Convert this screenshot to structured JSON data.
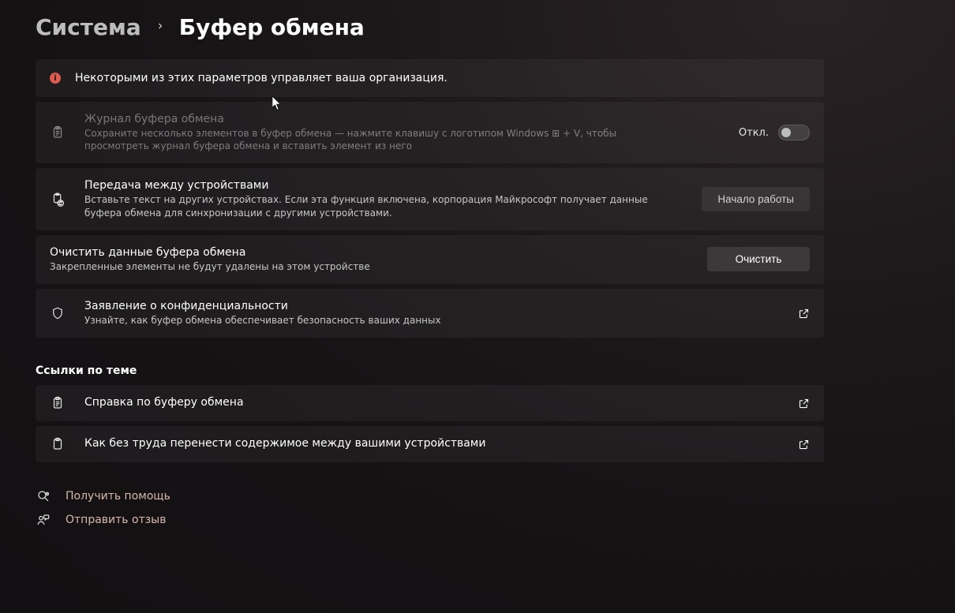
{
  "breadcrumb": {
    "parent": "Система",
    "current": "Буфер обмена"
  },
  "banner": {
    "text": "Некоторыми из этих параметров управляет ваша организация."
  },
  "cards": {
    "history": {
      "title": "Журнал буфера обмена",
      "sub": "Сохраните несколько элементов в буфер обмена — нажмите клавишу с логотипом Windows ⊞ + V, чтобы просмотреть журнал буфера обмена и вставить элемент из него",
      "toggle_state": "Откл."
    },
    "sync": {
      "title": "Передача между устройствами",
      "sub": "Вставьте текст на других устройствах. Если эта функция включена, корпорация Майкрософт получает данные буфера обмена для синхронизации с другими устройствами.",
      "button": "Начало работы"
    },
    "clear": {
      "title": "Очистить данные буфера обмена",
      "sub": "Закрепленные элементы не будут удалены на этом устройстве",
      "button": "Очистить"
    },
    "privacy": {
      "title": "Заявление о конфиденциальности",
      "sub": "Узнайте, как буфер обмена обеспечивает безопасность ваших данных"
    }
  },
  "related": {
    "heading": "Ссылки по теме",
    "help": "Справка по буферу обмена",
    "transfer": "Как без труда перенести содержимое между вашими устройствами"
  },
  "footer": {
    "get_help": "Получить помощь",
    "feedback": "Отправить отзыв"
  }
}
